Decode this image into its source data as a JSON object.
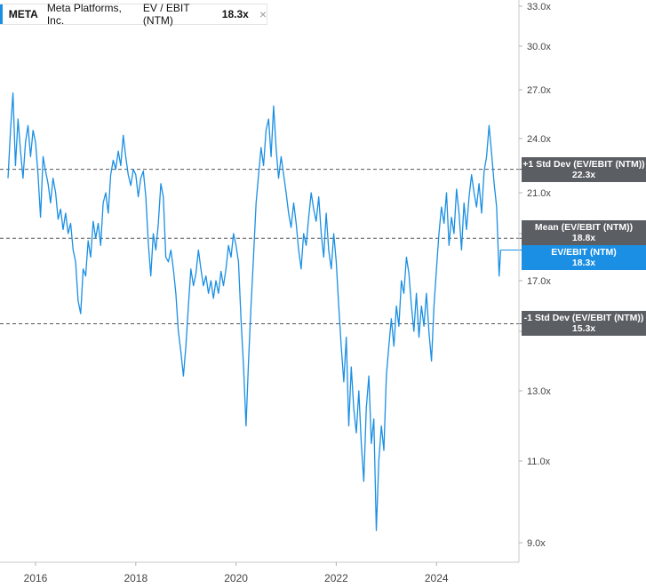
{
  "legend": {
    "ticker": "META",
    "company": "Meta Platforms, Inc.",
    "metric": "EV / EBIT (NTM)",
    "value": "18.3x",
    "close_icon": "close-icon",
    "color": "#1a8fe3"
  },
  "reference_lines": [
    {
      "key": "plus1",
      "label": "+1 Std Dev (EV/EBIT (NTM))",
      "value": 22.3,
      "value_label": "22.3x"
    },
    {
      "key": "mean",
      "label": "Mean (EV/EBIT (NTM))",
      "value": 18.8,
      "value_label": "18.8x"
    },
    {
      "key": "minus1",
      "label": "-1 Std Dev (EV/EBIT (NTM))",
      "value": 15.3,
      "value_label": "15.3x"
    }
  ],
  "current_tag": {
    "label": "EV/EBIT (NTM)",
    "value": 18.3,
    "value_label": "18.3x"
  },
  "chart_data": {
    "type": "line",
    "y_ticks": [
      "33.0x",
      "30.0x",
      "27.0x",
      "24.0x",
      "21.0x",
      "19.0x",
      "17.0x",
      "15.0x",
      "13.0x",
      "11.0x",
      "9.0x"
    ],
    "x_ticks": [
      "2016",
      "2018",
      "2020",
      "2022",
      "2024"
    ],
    "xlim": [
      2015.45,
      2025.8
    ],
    "grid": false,
    "legend_position": "top-left",
    "series": [
      {
        "color": "#1a8fe3",
        "points": [
          [
            2015.45,
            21.8
          ],
          [
            2015.5,
            24.5
          ],
          [
            2015.55,
            26.8
          ],
          [
            2015.6,
            22.5
          ],
          [
            2015.65,
            25.2
          ],
          [
            2015.7,
            23.3
          ],
          [
            2015.75,
            21.8
          ],
          [
            2015.8,
            23.8
          ],
          [
            2015.85,
            24.8
          ],
          [
            2015.9,
            23.0
          ],
          [
            2015.95,
            24.5
          ],
          [
            2016.0,
            23.8
          ],
          [
            2016.05,
            22.0
          ],
          [
            2016.1,
            19.8
          ],
          [
            2016.15,
            23.0
          ],
          [
            2016.2,
            22.2
          ],
          [
            2016.25,
            21.5
          ],
          [
            2016.3,
            20.5
          ],
          [
            2016.35,
            21.8
          ],
          [
            2016.4,
            21.0
          ],
          [
            2016.45,
            19.7
          ],
          [
            2016.5,
            20.2
          ],
          [
            2016.55,
            19.2
          ],
          [
            2016.6,
            20.0
          ],
          [
            2016.65,
            19.0
          ],
          [
            2016.7,
            19.5
          ],
          [
            2016.75,
            18.3
          ],
          [
            2016.8,
            17.8
          ],
          [
            2016.85,
            16.2
          ],
          [
            2016.9,
            15.7
          ],
          [
            2016.95,
            17.5
          ],
          [
            2017.0,
            17.2
          ],
          [
            2017.05,
            18.7
          ],
          [
            2017.1,
            18.0
          ],
          [
            2017.15,
            19.6
          ],
          [
            2017.2,
            18.8
          ],
          [
            2017.25,
            19.5
          ],
          [
            2017.3,
            18.5
          ],
          [
            2017.35,
            20.5
          ],
          [
            2017.4,
            21.0
          ],
          [
            2017.45,
            20.0
          ],
          [
            2017.5,
            22.0
          ],
          [
            2017.55,
            22.8
          ],
          [
            2017.6,
            22.3
          ],
          [
            2017.65,
            23.3
          ],
          [
            2017.7,
            22.5
          ],
          [
            2017.75,
            24.2
          ],
          [
            2017.8,
            23.0
          ],
          [
            2017.85,
            22.0
          ],
          [
            2017.9,
            21.4
          ],
          [
            2017.95,
            22.3
          ],
          [
            2018.0,
            22.0
          ],
          [
            2018.05,
            20.8
          ],
          [
            2018.1,
            21.8
          ],
          [
            2018.15,
            22.2
          ],
          [
            2018.2,
            20.8
          ],
          [
            2018.25,
            18.6
          ],
          [
            2018.3,
            17.2
          ],
          [
            2018.35,
            19.0
          ],
          [
            2018.4,
            18.3
          ],
          [
            2018.45,
            19.5
          ],
          [
            2018.5,
            21.5
          ],
          [
            2018.55,
            20.8
          ],
          [
            2018.6,
            18.0
          ],
          [
            2018.65,
            17.8
          ],
          [
            2018.7,
            18.3
          ],
          [
            2018.75,
            17.5
          ],
          [
            2018.8,
            16.5
          ],
          [
            2018.85,
            15.0
          ],
          [
            2018.9,
            14.3
          ],
          [
            2018.95,
            13.5
          ],
          [
            2019.0,
            14.5
          ],
          [
            2019.05,
            16.0
          ],
          [
            2019.1,
            17.5
          ],
          [
            2019.15,
            16.8
          ],
          [
            2019.2,
            17.3
          ],
          [
            2019.25,
            18.3
          ],
          [
            2019.3,
            17.5
          ],
          [
            2019.35,
            16.8
          ],
          [
            2019.4,
            17.2
          ],
          [
            2019.45,
            16.5
          ],
          [
            2019.5,
            17.0
          ],
          [
            2019.55,
            16.3
          ],
          [
            2019.6,
            17.0
          ],
          [
            2019.65,
            16.5
          ],
          [
            2019.7,
            17.4
          ],
          [
            2019.75,
            16.8
          ],
          [
            2019.8,
            17.5
          ],
          [
            2019.85,
            18.5
          ],
          [
            2019.9,
            18.0
          ],
          [
            2019.95,
            19.0
          ],
          [
            2020.0,
            18.5
          ],
          [
            2020.05,
            17.8
          ],
          [
            2020.1,
            15.5
          ],
          [
            2020.15,
            13.8
          ],
          [
            2020.2,
            12.0
          ],
          [
            2020.25,
            14.0
          ],
          [
            2020.3,
            16.0
          ],
          [
            2020.35,
            18.0
          ],
          [
            2020.4,
            20.5
          ],
          [
            2020.45,
            22.0
          ],
          [
            2020.5,
            23.5
          ],
          [
            2020.55,
            22.5
          ],
          [
            2020.6,
            24.5
          ],
          [
            2020.65,
            25.2
          ],
          [
            2020.7,
            23.0
          ],
          [
            2020.75,
            26.0
          ],
          [
            2020.8,
            23.5
          ],
          [
            2020.85,
            21.8
          ],
          [
            2020.9,
            23.0
          ],
          [
            2020.95,
            22.0
          ],
          [
            2021.0,
            21.0
          ],
          [
            2021.05,
            20.0
          ],
          [
            2021.1,
            19.3
          ],
          [
            2021.15,
            20.5
          ],
          [
            2021.2,
            19.5
          ],
          [
            2021.25,
            18.3
          ],
          [
            2021.3,
            17.5
          ],
          [
            2021.35,
            19.0
          ],
          [
            2021.4,
            18.5
          ],
          [
            2021.45,
            19.8
          ],
          [
            2021.5,
            21.0
          ],
          [
            2021.55,
            20.2
          ],
          [
            2021.6,
            19.6
          ],
          [
            2021.65,
            20.8
          ],
          [
            2021.7,
            19.0
          ],
          [
            2021.75,
            18.0
          ],
          [
            2021.8,
            20.0
          ],
          [
            2021.85,
            18.3
          ],
          [
            2021.9,
            17.5
          ],
          [
            2021.95,
            19.0
          ],
          [
            2022.0,
            17.8
          ],
          [
            2022.05,
            16.0
          ],
          [
            2022.1,
            14.5
          ],
          [
            2022.15,
            13.3
          ],
          [
            2022.2,
            14.8
          ],
          [
            2022.25,
            12.0
          ],
          [
            2022.3,
            13.8
          ],
          [
            2022.35,
            12.5
          ],
          [
            2022.4,
            11.8
          ],
          [
            2022.45,
            13.0
          ],
          [
            2022.5,
            11.5
          ],
          [
            2022.55,
            10.5
          ],
          [
            2022.6,
            12.5
          ],
          [
            2022.65,
            13.5
          ],
          [
            2022.7,
            11.5
          ],
          [
            2022.75,
            12.2
          ],
          [
            2022.8,
            9.3
          ],
          [
            2022.85,
            11.0
          ],
          [
            2022.9,
            12.0
          ],
          [
            2022.95,
            11.3
          ],
          [
            2023.0,
            13.5
          ],
          [
            2023.05,
            14.5
          ],
          [
            2023.1,
            15.5
          ],
          [
            2023.15,
            14.5
          ],
          [
            2023.2,
            16.0
          ],
          [
            2023.25,
            15.2
          ],
          [
            2023.3,
            17.0
          ],
          [
            2023.35,
            16.5
          ],
          [
            2023.4,
            18.0
          ],
          [
            2023.45,
            17.3
          ],
          [
            2023.5,
            16.0
          ],
          [
            2023.55,
            15.0
          ],
          [
            2023.6,
            16.5
          ],
          [
            2023.65,
            14.8
          ],
          [
            2023.7,
            16.0
          ],
          [
            2023.75,
            15.2
          ],
          [
            2023.8,
            16.5
          ],
          [
            2023.85,
            15.0
          ],
          [
            2023.9,
            14.0
          ],
          [
            2023.95,
            16.0
          ],
          [
            2024.0,
            17.5
          ],
          [
            2024.05,
            19.0
          ],
          [
            2024.1,
            20.3
          ],
          [
            2024.15,
            19.5
          ],
          [
            2024.2,
            21.0
          ],
          [
            2024.25,
            18.5
          ],
          [
            2024.3,
            19.8
          ],
          [
            2024.35,
            19.0
          ],
          [
            2024.4,
            21.2
          ],
          [
            2024.45,
            20.0
          ],
          [
            2024.5,
            18.3
          ],
          [
            2024.55,
            20.5
          ],
          [
            2024.6,
            19.2
          ],
          [
            2024.65,
            20.8
          ],
          [
            2024.7,
            22.0
          ],
          [
            2024.75,
            21.0
          ],
          [
            2024.8,
            20.3
          ],
          [
            2024.85,
            21.5
          ],
          [
            2024.9,
            20.0
          ],
          [
            2024.95,
            22.2
          ],
          [
            2025.0,
            23.0
          ],
          [
            2025.05,
            24.8
          ],
          [
            2025.1,
            23.2
          ],
          [
            2025.15,
            21.5
          ],
          [
            2025.2,
            20.3
          ],
          [
            2025.25,
            17.2
          ],
          [
            2025.28,
            18.3
          ]
        ]
      }
    ]
  }
}
